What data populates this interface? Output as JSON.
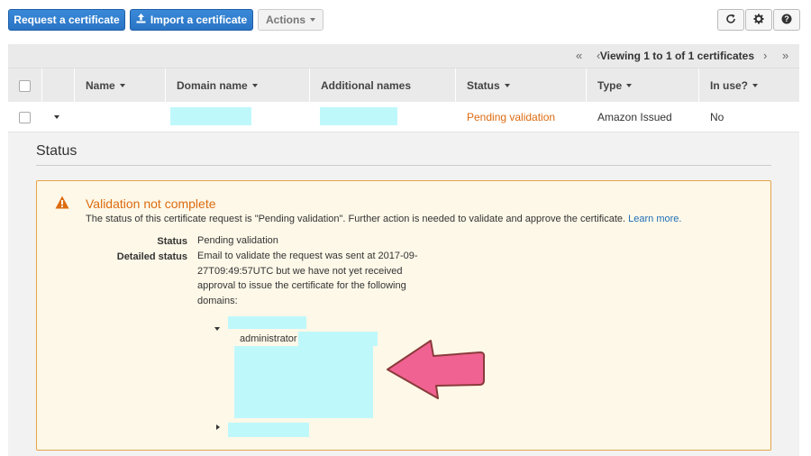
{
  "toolbar": {
    "request_label": "Request a certificate",
    "import_label": "Import a certificate",
    "actions_label": "Actions"
  },
  "icons": {
    "refresh": "refresh-icon",
    "settings": "gear-icon",
    "help": "help-icon",
    "upload": "upload-icon",
    "warning": "warning-icon"
  },
  "pager": {
    "text": "Viewing 1 to 1 of 1 certificates",
    "first": "«",
    "prev": "‹",
    "next": "›",
    "last": "»"
  },
  "table": {
    "columns": [
      "Name",
      "Domain name",
      "Additional names",
      "Status",
      "Type",
      "In use?"
    ],
    "rows": [
      {
        "name": "",
        "domain": "",
        "additional": "",
        "status": "Pending validation",
        "type": "Amazon Issued",
        "in_use": "No"
      }
    ]
  },
  "detail": {
    "heading": "Status",
    "alert_title": "Validation not complete",
    "alert_desc": "The status of this certificate request is \"Pending validation\". Further action is needed to validate and approve the certificate.",
    "learn_more": "Learn more.",
    "status_label": "Status",
    "status_value": "Pending validation",
    "detailed_label": "Detailed status",
    "detailed_lines": [
      "Email to validate the request was sent at 2017-09-",
      "27T09:49:57UTC but we have not yet received",
      "approval to issue the certificate for the following",
      "domains:"
    ],
    "email_prefix": "administrator"
  },
  "colors": {
    "primary": "#2f7fd0",
    "pending": "#dd6b10",
    "alert_border": "#e4a44a",
    "alert_bg": "#fdf8e8",
    "redaction": "#bff8fb",
    "arrow": "#f06292"
  }
}
